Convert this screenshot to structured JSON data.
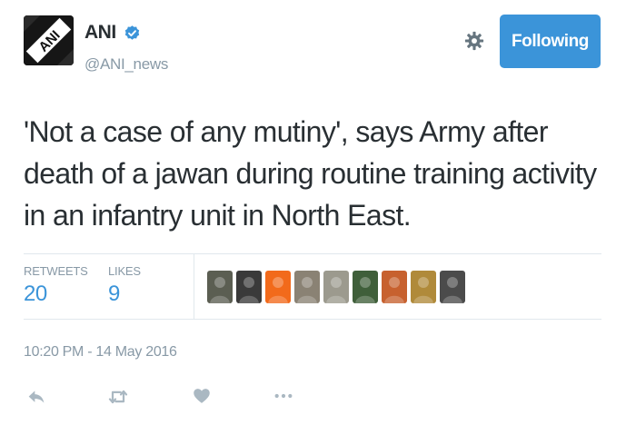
{
  "author": {
    "display_name": "ANI",
    "handle": "@ANI_news",
    "verified": true,
    "avatar_text": "ANI"
  },
  "follow_button": {
    "label": "Following"
  },
  "tweet": {
    "text": "'Not a case of any mutiny', says Army after death of a jawan during routine training activity in an infantry unit in North East.",
    "timestamp": "10:20 PM - 14 May 2016"
  },
  "stats": {
    "retweets_label": "RETWEETS",
    "retweets_value": "20",
    "likes_label": "LIKES",
    "likes_value": "9"
  },
  "likers": [
    {
      "color": "#5b5e52"
    },
    {
      "color": "#3a3a3a"
    },
    {
      "color": "#f26a1b"
    },
    {
      "color": "#8a8274"
    },
    {
      "color": "#9c9a8e"
    },
    {
      "color": "#3f5f3a"
    },
    {
      "color": "#c7612f"
    },
    {
      "color": "#b08a3a"
    },
    {
      "color": "#4b4b4b"
    }
  ],
  "actions": [
    "reply-icon",
    "retweet-icon",
    "like-icon",
    "more-icon"
  ],
  "colors": {
    "accent": "#3b94d9",
    "muted": "#8899a6",
    "text": "#292f33",
    "divider": "#e1e8ed",
    "action_icon": "#aab8c2"
  }
}
